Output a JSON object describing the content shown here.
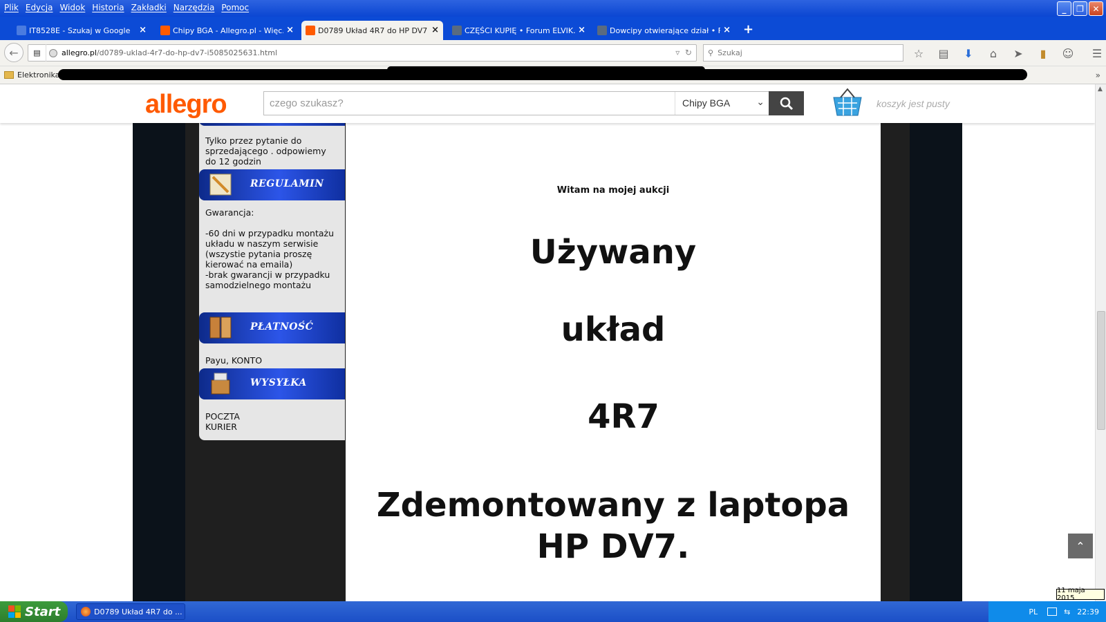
{
  "menu": [
    "Plik",
    "Edycja",
    "Widok",
    "Historia",
    "Zakładki",
    "Narzędzia",
    "Pomoc"
  ],
  "window_buttons": {
    "minimize": "_",
    "maximize": "❐",
    "close": "✕"
  },
  "tabs": [
    {
      "title": "IT8528E - Szukaj w Google",
      "icon": "google-icon",
      "color": "#4a7be0"
    },
    {
      "title": "Chipy BGA - Allegro.pl - Więc...",
      "icon": "allegro-icon",
      "color": "#ff5a00"
    },
    {
      "title": "D0789 Układ 4R7 do HP DV7 (...",
      "icon": "allegro-icon",
      "color": "#ff5a00"
    },
    {
      "title": "CZĘŚCI KUPIĘ • Forum ELVIK...",
      "icon": "forum-icon",
      "color": "#5a6b80"
    },
    {
      "title": "Dowcipy otwierające dział • F...",
      "icon": "forum-icon",
      "color": "#5a6b80"
    }
  ],
  "active_tab": 2,
  "new_tab": "+",
  "url": {
    "domain": "allegro.pl",
    "path": "/d0789-uklad-4r7-do-hp-dv7-i5085025631.html"
  },
  "browser_search_placeholder": "Szukaj",
  "bookmarks": {
    "folder": "Elektronika",
    "more": "»"
  },
  "site": {
    "logo": "allegro",
    "search_placeholder": "czego szukasz?",
    "category": "Chipy BGA",
    "cart": "koszyk jest pusty"
  },
  "sidebar": {
    "contact_text": "Tylko przez pytanie do\nsprzedającego . odpowiemy\ndo 12 godzin",
    "sections": [
      {
        "title": "REGULAMIN",
        "icon": "pencil-icon"
      },
      {
        "title": "PŁATNOŚĆ",
        "icon": "wallet-icon"
      },
      {
        "title": "WYSYŁKA",
        "icon": "box-icon"
      }
    ],
    "regulamin_text": " Gwarancja:\n\n-60 dni w przypadku montażu\nukładu w naszym serwisie\n(wszystie pytania proszę\nkierować na emaila)\n-brak gwarancji w przypadku\nsamodzielnego montażu",
    "platnosc_text": "Payu, KONTO",
    "wysylka_text": "POCZTA\nKURIER"
  },
  "main": {
    "welcome": "Witam na mojej aukcji",
    "line1": "Używany",
    "line2": "układ",
    "line3": "4R7",
    "line4": "Zdemontowany z laptopa",
    "line5": "HP DV7."
  },
  "back_to_top": "⌃",
  "taskbar": {
    "start": "Start",
    "task": "D0789 Układ 4R7 do ...",
    "lang": "PL",
    "time": "22:39",
    "date": "11 maja 2015"
  }
}
